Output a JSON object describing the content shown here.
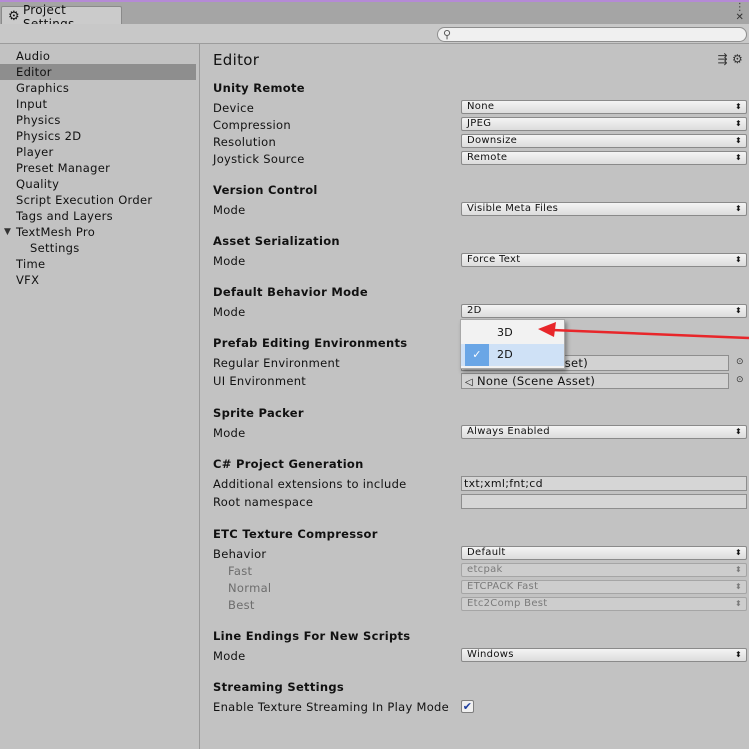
{
  "window": {
    "tab_label": "Project Settings",
    "menu_glyph": "⋮",
    "close_glyph": "✕",
    "search_placeholder": ""
  },
  "sidebar": {
    "items": [
      {
        "label": "Audio"
      },
      {
        "label": "Editor",
        "selected": true
      },
      {
        "label": "Graphics"
      },
      {
        "label": "Input"
      },
      {
        "label": "Physics"
      },
      {
        "label": "Physics 2D"
      },
      {
        "label": "Player"
      },
      {
        "label": "Preset Manager"
      },
      {
        "label": "Quality"
      },
      {
        "label": "Script Execution Order"
      },
      {
        "label": "Tags and Layers"
      },
      {
        "label": "TextMesh Pro",
        "expanded": true
      },
      {
        "label": "Settings",
        "child": true
      },
      {
        "label": "Time"
      },
      {
        "label": "VFX"
      }
    ]
  },
  "page": {
    "title": "Editor",
    "unity_remote": {
      "header": "Unity Remote",
      "device_label": "Device",
      "device_value": "None",
      "compression_label": "Compression",
      "compression_value": "JPEG",
      "resolution_label": "Resolution",
      "resolution_value": "Downsize",
      "joystick_label": "Joystick Source",
      "joystick_value": "Remote"
    },
    "version_control": {
      "header": "Version Control",
      "mode_label": "Mode",
      "mode_value": "Visible Meta Files"
    },
    "asset_serialization": {
      "header": "Asset Serialization",
      "mode_label": "Mode",
      "mode_value": "Force Text"
    },
    "default_behavior": {
      "header": "Default Behavior Mode",
      "mode_label": "Mode",
      "mode_value": "2D"
    },
    "prefab_env": {
      "header": "Prefab Editing Environments",
      "regular_label": "Regular Environment",
      "regular_value": "sset)",
      "ui_label": "UI Environment",
      "ui_value": "None (Scene Asset)"
    },
    "sprite_packer": {
      "header": "Sprite Packer",
      "mode_label": "Mode",
      "mode_value": "Always Enabled"
    },
    "csharp": {
      "header": "C# Project Generation",
      "ext_label": "Additional extensions to include",
      "ext_value": "txt;xml;fnt;cd",
      "ns_label": "Root namespace",
      "ns_value": ""
    },
    "etc": {
      "header": "ETC Texture Compressor",
      "behavior_label": "Behavior",
      "behavior_value": "Default",
      "fast_label": "Fast",
      "fast_value": "etcpak",
      "normal_label": "Normal",
      "normal_value": "ETCPACK Fast",
      "best_label": "Best",
      "best_value": "Etc2Comp Best"
    },
    "line_endings": {
      "header": "Line Endings For New Scripts",
      "mode_label": "Mode",
      "mode_value": "Windows"
    },
    "streaming": {
      "header": "Streaming Settings",
      "texture_label": "Enable Texture Streaming In Play Mode",
      "texture_checked": true
    }
  },
  "popup": {
    "options": [
      {
        "label": "3D",
        "checked": false
      },
      {
        "label": "2D",
        "checked": true
      }
    ],
    "check_glyph": "✓"
  },
  "annotation": {
    "arrow_color": "#e8262a"
  },
  "glyphs": {
    "dropdown_arrow": "⬍",
    "object_picker": "⊙",
    "checkbox_mark": "✔"
  }
}
